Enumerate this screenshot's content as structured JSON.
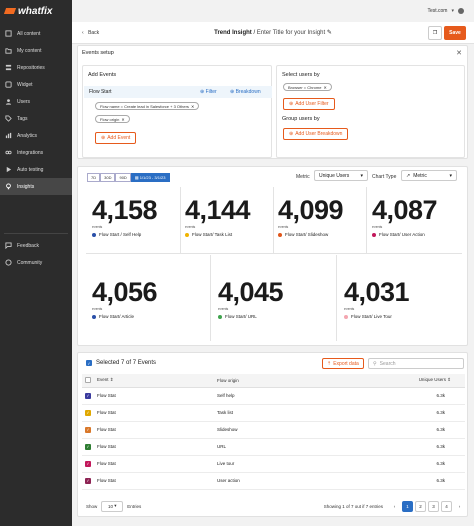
{
  "brand": {
    "logo_text": "whatfix",
    "accent": "#e65a1c"
  },
  "sidebar": {
    "items": [
      {
        "label": "All content",
        "icon": "content-icon"
      },
      {
        "label": "My content",
        "icon": "folder-icon"
      },
      {
        "label": "Repositories",
        "icon": "repository-icon"
      },
      {
        "label": "Widget",
        "icon": "widget-icon"
      },
      {
        "label": "Users",
        "icon": "users-icon"
      },
      {
        "label": "Tags",
        "icon": "tag-icon"
      },
      {
        "label": "Analytics",
        "icon": "analytics-icon"
      },
      {
        "label": "Integrations",
        "icon": "integrations-icon"
      },
      {
        "label": "Auto testing",
        "icon": "auto-testing-icon"
      },
      {
        "label": "Insights",
        "icon": "insights-icon"
      }
    ],
    "bottom_items": [
      {
        "label": "Feedback",
        "icon": "feedback-icon"
      },
      {
        "label": "Community",
        "icon": "community-icon"
      }
    ]
  },
  "topbar": {
    "account": "Test.com"
  },
  "header": {
    "back_label": "Back",
    "title_bold": "Trend Insight",
    "title_sep": " / ",
    "title_placeholder": "Enter Title for your Insight",
    "save_label": "Save"
  },
  "setup": {
    "title": "Events setup",
    "add_events": {
      "title": "Add Events",
      "event_name": "Flow Start",
      "filter_label": "Filter",
      "breakdown_label": "Breakdown",
      "chips": [
        "Flow name = Create lead in Salesforce + 3 Others",
        "Flow origin"
      ],
      "add_event_label": "Add Event"
    },
    "select_users": {
      "title": "Select users by",
      "chip": "Browser = Chrome",
      "add_filter_label": "Add User Filter",
      "group_title": "Group users by",
      "add_breakdown_label": "Add User Breakdown"
    }
  },
  "controls": {
    "date_ranges": [
      "7D",
      "30D",
      "90D"
    ],
    "custom_range": "1/1/23 - 3/1/23",
    "metric_label": "Metric",
    "metric_value": "Unique Users",
    "chart_type_label": "Chart Type",
    "chart_type_value": "Metric"
  },
  "metrics": [
    {
      "value": "4,158",
      "unit": "events",
      "label": "Flow Start / Self Help",
      "color": "#2a4fa8"
    },
    {
      "value": "4,144",
      "unit": "events",
      "label": "Flow Start/ Task List",
      "color": "#f0b400"
    },
    {
      "value": "4,099",
      "unit": "events",
      "label": "Flow Start/ Slideshow",
      "color": "#e0561a"
    },
    {
      "value": "4,087",
      "unit": "events",
      "label": "Flow Start/ User Action",
      "color": "#c2185b"
    },
    {
      "value": "4,056",
      "unit": "events",
      "label": "Flow Start/ Article",
      "color": "#2a4fa8"
    },
    {
      "value": "4,045",
      "unit": "events",
      "label": "Flow Start/ URL",
      "color": "#3fa34d"
    },
    {
      "value": "4,031",
      "unit": "events",
      "label": "Flow Start/ Live Tour",
      "color": "#f4a6b0"
    }
  ],
  "table": {
    "selected_label": "Selected 7 of 7 Events",
    "export_label": "Export data",
    "search_placeholder": "Search",
    "columns": [
      "Event",
      "Flow origin",
      "Unique Users"
    ],
    "rows": [
      {
        "event": "Flow Stat",
        "origin": "Self help",
        "users": "6.3k",
        "color": "#3b3b9e"
      },
      {
        "event": "Flow Stat",
        "origin": "Task list",
        "users": "6.3k",
        "color": "#e0a800"
      },
      {
        "event": "Flow Stat",
        "origin": "Slideshow",
        "users": "6.3k",
        "color": "#d9782a"
      },
      {
        "event": "Flow Stat",
        "origin": "URL",
        "users": "6.3k",
        "color": "#2e7d32"
      },
      {
        "event": "Flow Stat",
        "origin": "Live tour",
        "users": "6.3k",
        "color": "#c2185b"
      },
      {
        "event": "Flow Stat",
        "origin": "User action",
        "users": "6.3k",
        "color": "#8e2454"
      }
    ],
    "show_label": "Show",
    "page_size": "10",
    "entries_label": "Entries",
    "summary": "Showing 1 of 7 out if 7 entries",
    "pages": [
      "1",
      "2",
      "3",
      "4"
    ]
  }
}
